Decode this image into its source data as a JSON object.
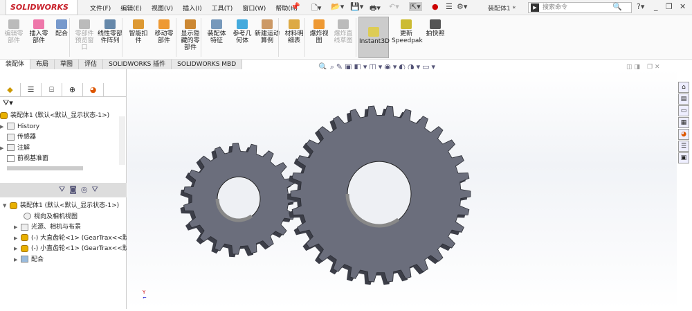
{
  "app": {
    "logo": "SOLIDWORKS",
    "document_title": "装配体1 *",
    "search_placeholder": "搜索命令"
  },
  "menu": [
    "文件(F)",
    "编辑(E)",
    "视图(V)",
    "插入(I)",
    "工具(T)",
    "窗口(W)",
    "帮助(H)"
  ],
  "ribbon": [
    {
      "label": "编辑零部件",
      "disabled": true
    },
    {
      "label": "插入零部件",
      "disabled": false
    },
    {
      "label": "配合",
      "disabled": false
    },
    {
      "label": "零部件预览窗口",
      "disabled": true
    },
    {
      "label": "线性零部件阵列",
      "disabled": false
    },
    {
      "label": "智能扣件",
      "disabled": false
    },
    {
      "label": "移动零部件",
      "disabled": false
    },
    {
      "label": "显示隐藏的零部件",
      "disabled": false
    },
    {
      "label": "装配体特征",
      "disabled": false
    },
    {
      "label": "参考几何体",
      "disabled": false
    },
    {
      "label": "新建运动算例",
      "disabled": false
    },
    {
      "label": "材料明细表",
      "disabled": false
    },
    {
      "label": "爆炸视图",
      "disabled": false
    },
    {
      "label": "爆炸直线草图",
      "disabled": true
    },
    {
      "label": "Instant3D",
      "disabled": false,
      "active": true
    },
    {
      "label": "更新Speedpak",
      "disabled": false
    },
    {
      "label": "拍快照",
      "disabled": false
    }
  ],
  "tabs": [
    "装配体",
    "布局",
    "草图",
    "评估",
    "SOLIDWORKS 插件",
    "SOLIDWORKS MBD"
  ],
  "tree_top": [
    "装配体1  (默认<默认_显示状态-1>)",
    "History",
    "传感器",
    "注解",
    "前视基准面"
  ],
  "tree_bottom": [
    "装配体1  (默认<默认_显示状态-1>)",
    "视向及相机视图",
    "光源、相机与布景",
    "(-) 大直齿轮<1> (GearTrax<<默",
    "(-) 小直齿轮<1> (GearTrax<<默",
    "配合"
  ],
  "colors": {
    "gear": "#6b6e7c",
    "brand": "#c8202a"
  }
}
